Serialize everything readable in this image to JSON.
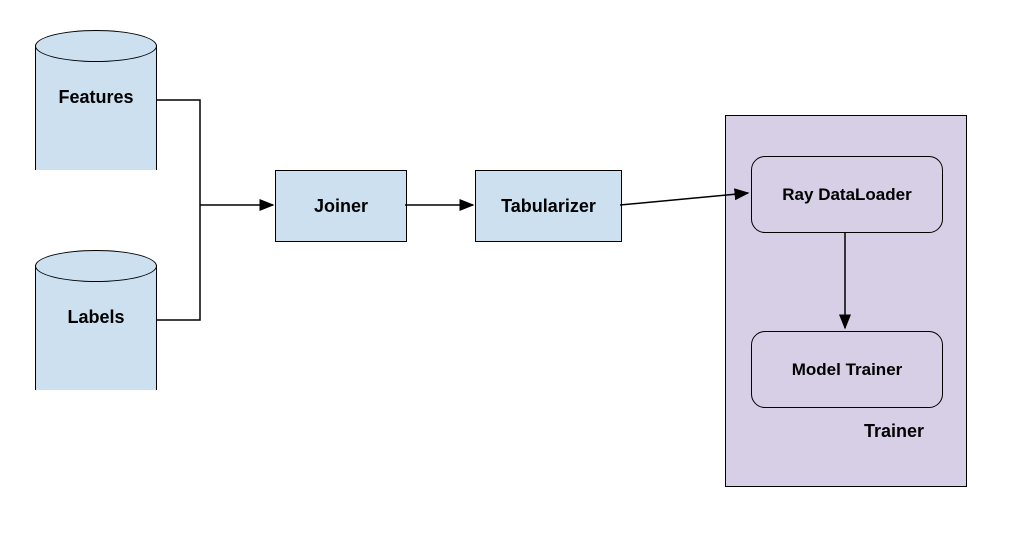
{
  "nodes": {
    "features": "Features",
    "labels": "Labels",
    "joiner": "Joiner",
    "tabularizer": "Tabularizer",
    "dataloader": "Ray DataLoader",
    "modeltrainer": "Model Trainer",
    "trainer_container": "Trainer"
  }
}
